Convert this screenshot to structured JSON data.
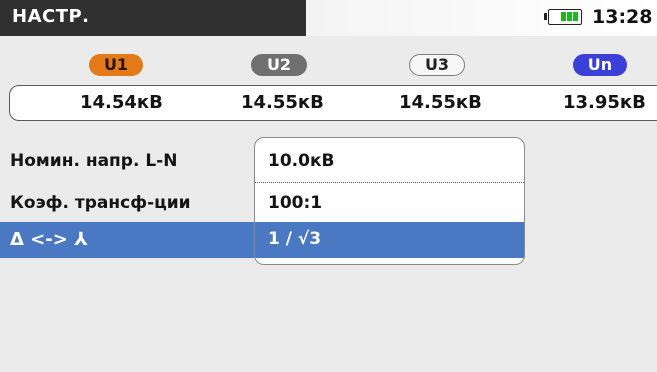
{
  "header": {
    "title": "НАСТР.",
    "time": "13:28"
  },
  "phases": [
    {
      "label": "U1",
      "value": "14.54кВ"
    },
    {
      "label": "U2",
      "value": "14.55кВ"
    },
    {
      "label": "U3",
      "value": "14.55кВ"
    },
    {
      "label": "Un",
      "value": "13.95кВ"
    }
  ],
  "settings": {
    "rows": [
      {
        "label": "Номин. напр. L-N",
        "value": "10.0кВ"
      },
      {
        "label": "Коэф. трансф-ции",
        "value": "100:1"
      },
      {
        "label": "Δ <-> ⅄",
        "value": "1 / √3"
      }
    ],
    "selected_index": 2
  },
  "colors": {
    "header_bg": "#303030",
    "u1": "#e27a1a",
    "u2": "#6f6f6f",
    "un": "#3a40d8",
    "selection": "#4b78c2",
    "battery": "#22b422"
  }
}
